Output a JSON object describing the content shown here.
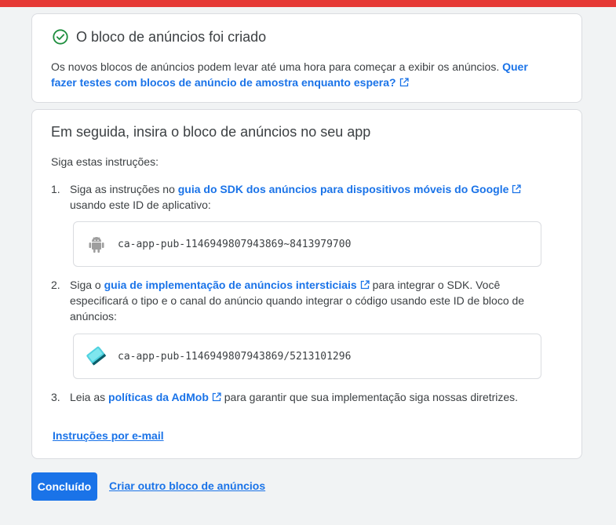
{
  "success_card": {
    "title": "O bloco de anúncios foi criado",
    "text": "Os novos blocos de anúncios podem levar até uma hora para começar a exibir os anúncios.",
    "link": "Quer fazer testes com blocos de anúncio de amostra enquanto espera?"
  },
  "instructions_card": {
    "title": "Em seguida, insira o bloco de anúncios no seu app",
    "intro": "Siga estas instruções:",
    "steps": [
      {
        "num": "1.",
        "before": "Siga as instruções no",
        "link": "guia do SDK dos anúncios para dispositivos móveis do Google",
        "after": "usando este ID de aplicativo:",
        "id_value": "ca-app-pub-1146949807943869~8413979700",
        "icon": "android-icon"
      },
      {
        "num": "2.",
        "before": "Siga o",
        "link": "guia de implementação de anúncios intersticiais",
        "after": "para integrar o SDK. Você especificará o tipo e o canal do anúncio quando integrar o código usando este ID de bloco de anúncios:",
        "id_value": "ca-app-pub-1146949807943869/5213101296",
        "icon": "ad-unit-icon"
      },
      {
        "num": "3.",
        "before": "Leia as",
        "link": "políticas da AdMob",
        "after": "para garantir que sua implementação siga nossas diretrizes."
      }
    ],
    "email_link": "Instruções por e-mail"
  },
  "actions": {
    "done_label": "Concluído",
    "create_another_label": "Criar outro bloco de anúncios"
  },
  "colors": {
    "accent": "#1a73e8",
    "top_bar": "#e53935",
    "success": "#1e8e3e"
  }
}
